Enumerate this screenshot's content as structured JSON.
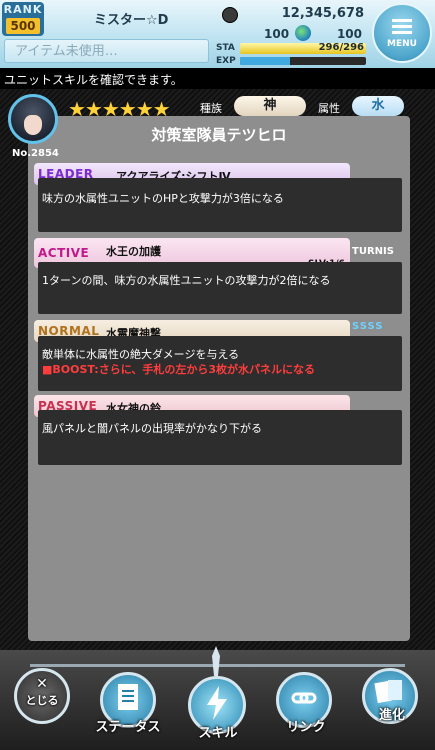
{
  "header": {
    "rank_label": "RANK",
    "rank_value": "500",
    "player_name": "ミスター☆D",
    "coins": "12,345,678",
    "item_status": "アイテム未使用…",
    "gem_left": "100",
    "gem_right": "100",
    "sta_label": "STA",
    "sta_value": "296/296",
    "sta_fraction": 1.0,
    "exp_label": "EXP",
    "menu_label": "MENU"
  },
  "info": {
    "text": "ユニットスキルを確認できます。"
  },
  "unit": {
    "number": "No.2854",
    "stars": "★★★★★★",
    "type_label": "種族",
    "type_value": "神",
    "attr_label": "属性",
    "attr_value": "水",
    "name": "対策室隊員テツヒロ"
  },
  "skills": {
    "leader": {
      "tag": "LEADER",
      "name": "アクアライズ:シフトⅣ",
      "desc": "味方の水属性ユニットのHPと攻撃力が3倍になる"
    },
    "active": {
      "tag": "ACTIVE",
      "name": "水王の加護",
      "level": "SLV:1/6",
      "turns": "TURNIS",
      "desc": "1ターンの間、味方の水属性ユニットの攻撃力が2倍になる"
    },
    "normal": {
      "tag": "NORMAL",
      "name": "水霊魔神撃",
      "rank": "SSSS",
      "desc": "敵単体に水属性の絶大ダメージを与える",
      "boost": "■BOOST:さらに、手札の左から3枚が水パネルになる"
    },
    "passive": {
      "tag": "PASSIVE",
      "name": "水女神の鈴",
      "desc": "風パネルと闇パネルの出現率がかなり下がる"
    }
  },
  "nav": {
    "close": "とじる",
    "close_mark": "✕",
    "status": "ステータス",
    "skill": "スキル",
    "link": "リンク",
    "evolve": "進化"
  },
  "colors": {
    "leader_tag": "#7b2bd1",
    "active_tag": "#c2188a",
    "normal_tag": "#b0721c",
    "passive_tag": "#c8304f",
    "accent": "#62c2ea"
  }
}
